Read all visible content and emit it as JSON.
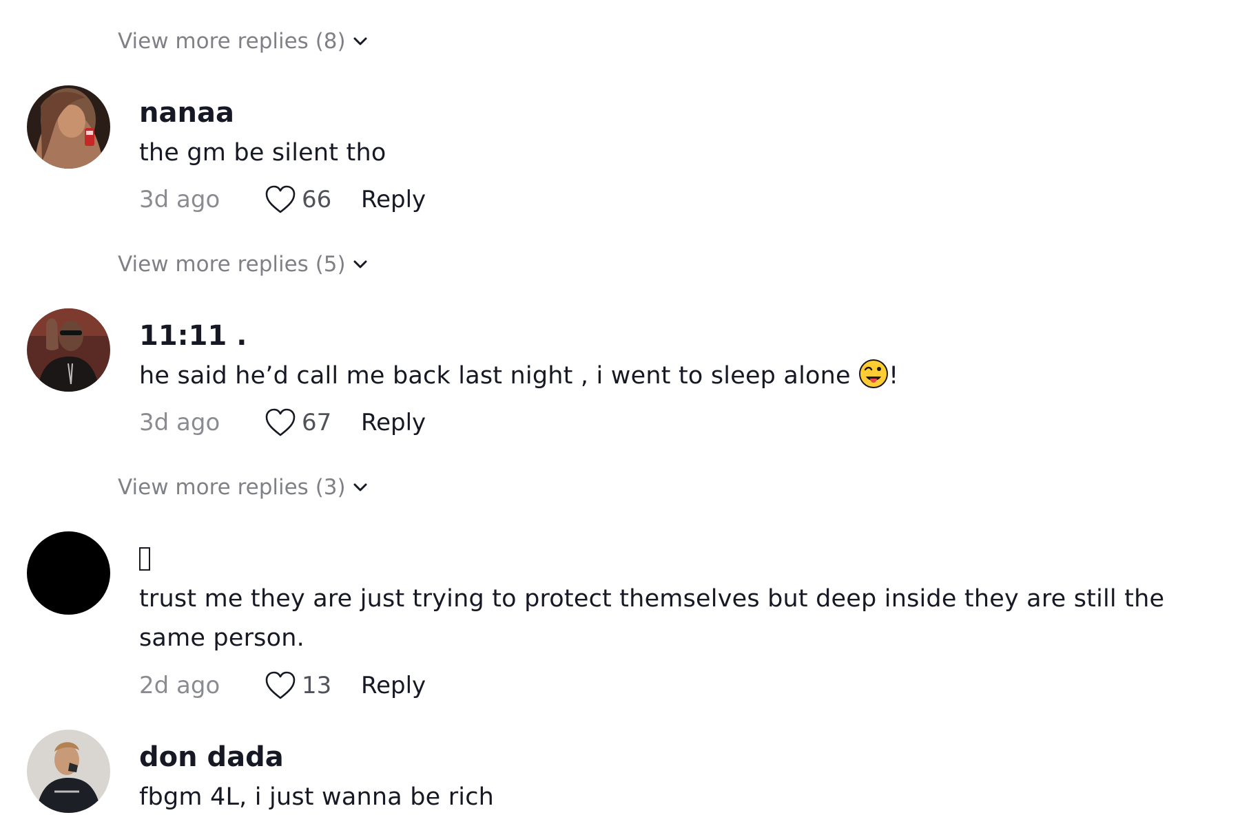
{
  "comments": [
    {
      "view_more_before": "View more replies (8)",
      "username": "nanaa",
      "text": "the gm be silent tho",
      "time": "3d ago",
      "likes": "66",
      "reply_label": "Reply"
    },
    {
      "view_more_before": "View more replies (5)",
      "username": "11:11 .",
      "text": "he said he’d call me back last night , i went to sleep alone",
      "text_suffix": "!",
      "emoji": "winking-tongue-face",
      "time": "3d ago",
      "likes": "67",
      "reply_label": "Reply"
    },
    {
      "view_more_before": "View more replies (3)",
      "username": "",
      "text": "trust me they are just trying to protect themselves but deep inside they are still the same person.",
      "time": "2d ago",
      "likes": "13",
      "reply_label": "Reply"
    },
    {
      "username": "don dada",
      "text": "fbgm 4L, i just wanna be rich"
    }
  ],
  "icons": {
    "chevron": "chevron-down-icon",
    "like": "heart-outline-icon"
  }
}
